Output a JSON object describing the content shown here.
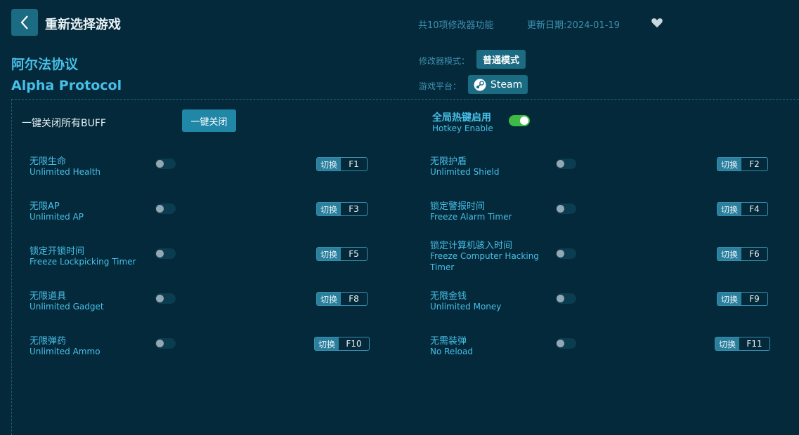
{
  "header": {
    "back_icon": "chevron-left-icon",
    "title": "重新选择游戏",
    "feature_count": "共10项修改器功能",
    "update_date": "更新日期:2024-01-19",
    "favorite_icon": "heart-icon"
  },
  "game": {
    "name_cn": "阿尔法协议",
    "name_en": "Alpha Protocol"
  },
  "meta": {
    "mode_label": "修改器模式：",
    "mode_value": "普通模式",
    "platform_label": "游戏平台：",
    "platform_value": "Steam",
    "platform_icon": "steam-icon"
  },
  "controls": {
    "buff_label": "一键关闭所有BUFF",
    "close_all_button": "一键关闭",
    "hotkey_cn": "全局热键启用",
    "hotkey_en": "Hotkey Enable",
    "hotkey_enabled": true
  },
  "colors": {
    "background": "#04293a",
    "accent": "#47bfe8",
    "button": "#1b6b82",
    "toggle_on": "#3dbb44"
  },
  "switch_label": "切换",
  "cheats": [
    {
      "cn": "无限生命",
      "en": "Unlimited Health",
      "key": "F1",
      "enabled": false
    },
    {
      "cn": "无限护盾",
      "en": "Unlimited Shield",
      "key": "F2",
      "enabled": false
    },
    {
      "cn": "无限AP",
      "en": "Unlimited AP",
      "key": "F3",
      "enabled": false
    },
    {
      "cn": "锁定警报时间",
      "en": "Freeze Alarm Timer",
      "key": "F4",
      "enabled": false
    },
    {
      "cn": "锁定开锁时间",
      "en": "Freeze Lockpicking Timer",
      "key": "F5",
      "enabled": false
    },
    {
      "cn": "锁定计算机骇入时间",
      "en": "Freeze Computer Hacking Timer",
      "key": "F6",
      "enabled": false
    },
    {
      "cn": "无限道具",
      "en": "Unlimited Gadget",
      "key": "F8",
      "enabled": false
    },
    {
      "cn": "无限金钱",
      "en": "Unlimited Money",
      "key": "F9",
      "enabled": false
    },
    {
      "cn": "无限弹药",
      "en": "Unlimited Ammo",
      "key": "F10",
      "enabled": false
    },
    {
      "cn": "无需装弹",
      "en": "No Reload",
      "key": "F11",
      "enabled": false
    }
  ]
}
